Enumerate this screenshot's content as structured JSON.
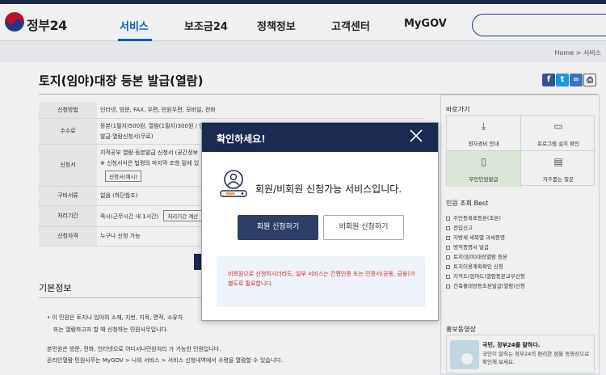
{
  "header": {
    "brand": "정부24",
    "nav": [
      "서비스",
      "보조금24",
      "정책정보",
      "고객센터",
      "MyGOV"
    ]
  },
  "breadcrumb": [
    "Home",
    "서비스"
  ],
  "page": {
    "title": "토지(임야)대장 등본 발급(열람)",
    "share_icons": [
      "facebook-icon",
      "twitter-icon",
      "link-icon",
      "print-icon"
    ]
  },
  "info_table": [
    {
      "label": "신청방법",
      "value": "인터넷, 방문, FAX, 우편, 민원우편, 모바일, 전화"
    },
    {
      "label": "수수료",
      "value": "등본(1필지)500원, 열람(1필지)300원 / 인터",
      "value2": "발급·열람신청서(무료)"
    },
    {
      "label": "신청서",
      "value": "지적공부 열람·등본발급 신청서 (공간정보",
      "value2": "※ 신청서식은 법령의 마지막 조항 밑에 있",
      "button": "신청서(예시)"
    },
    {
      "label": "구비서류",
      "value": "없음 (하단참조)"
    },
    {
      "label": "처리기간",
      "value": "즉시(근무시간 내 1시간)",
      "button": "처리기간 계산"
    },
    {
      "label": "신청자격",
      "value": "누구나 신청 가능"
    }
  ],
  "basic_info": {
    "title": "기본정보",
    "line1": "이 민원은 토지나 임야의 소재, 지번, 지목, 면적, 소유자",
    "line2": "또는 열람하고자 할 때 신청하는 민원사무입니다.",
    "line3": "본민원은 방문, 전화, 인터넷으로 어디서나민원처리 가 가능한 민원입니다.",
    "line4": "온라인열람 민원사무는 MyGOV > 나의 서비스 > 서비스 신청내역에서 수령을 열람할 수 있습니다."
  },
  "sidebar": {
    "quick_title": "바로가기",
    "quick_links": [
      {
        "label": "전자경비 안내",
        "icon": "download-icon"
      },
      {
        "label": "프로그램 설치 확인",
        "icon": "monitor-icon"
      },
      {
        "label": "무인민원발급",
        "icon": "kiosk-icon"
      },
      {
        "label": "자주묻는 질문",
        "icon": "chat-icon"
      }
    ],
    "best_title": "민원 조회 Best",
    "best_items": [
      "주민등록표등본(초본)",
      "전입신고",
      "지방세 세목별 과세증명",
      "병적증명서 발급",
      "토지(임야)대장열람 등본",
      "토지이용계획확인 신청",
      "지적도(임야도)열람등본교부신청",
      "건축물대장등초본발급(열람)신청"
    ],
    "promo_title": "홍보동영상",
    "promo_head": "국민, 정부24를 말하다.",
    "promo_desc": "국민이 말하는 정부24의 편리한 점을 동영상으로 확인해 보세요."
  },
  "modal": {
    "title": "확인하세요!",
    "message": "회원/비회원 신청가능 서비스입니다.",
    "member_button": "회원 신청하기",
    "guest_button": "비회원 신청하기",
    "note": "비회원으로 신청하시더라도, 일부 서비스는 간편인증 또는 인증서(공동, 금융)가 별도로 필요합니다."
  },
  "colors": {
    "brand_navy": "#1d2a4f",
    "nav_active": "#1360c8",
    "note_red": "#d4272b"
  }
}
